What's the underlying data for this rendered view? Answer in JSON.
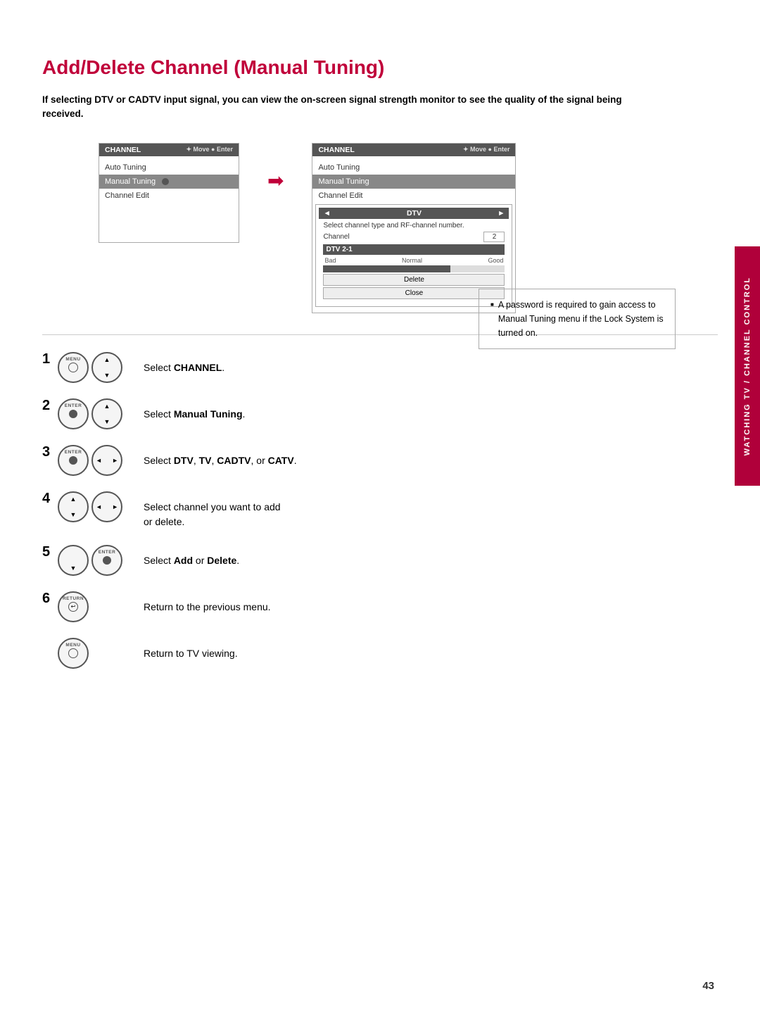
{
  "page": {
    "title": "Add/Delete Channel (Manual Tuning)",
    "description": "If selecting DTV or CADTV input signal, you can view the on-screen signal strength monitor to see the quality of the signal being received.",
    "page_number": "43",
    "side_tab": "WATCHING TV / CHANNEL CONTROL"
  },
  "menu1": {
    "header": "CHANNEL",
    "header_icons": "✦ Move  ● Enter",
    "item1": "Auto Tuning",
    "item2": "Manual Tuning",
    "item3": "Channel Edit"
  },
  "menu2": {
    "header": "CHANNEL",
    "header_icons": "✦ Move  ● Enter",
    "item1": "Auto Tuning",
    "item2": "Manual Tuning",
    "item3": "Channel Edit",
    "submenu_title": "DTV",
    "submenu_desc": "Select channel type and RF-channel number.",
    "submenu_channel_label": "Channel",
    "submenu_channel_value": "2",
    "submenu_dtv": "DTV 2-1",
    "submenu_bad": "Bad",
    "submenu_normal": "Normal",
    "submenu_good": "Good",
    "btn_delete": "Delete",
    "btn_close": "Close"
  },
  "steps": [
    {
      "number": "1",
      "icons": [
        "menu_circle",
        "nav_updown"
      ],
      "text": "Select ",
      "bold": "CHANNEL",
      "text_after": "."
    },
    {
      "number": "2",
      "icons": [
        "enter_circle",
        "nav_updown"
      ],
      "text": "Select ",
      "bold": "Manual  Tuning",
      "text_after": "."
    },
    {
      "number": "3",
      "icons": [
        "enter_circle",
        "nav_leftright"
      ],
      "text": "Select ",
      "bold_parts": [
        "DTV",
        "TV",
        "CADTV",
        "CATV"
      ],
      "text_template": "Select DTV, TV, CADTV, or CATV."
    },
    {
      "number": "4",
      "icons": [
        "nav_updown",
        "nav_leftright"
      ],
      "text": "Select channel you want to add\nor delete.",
      "bold": null
    },
    {
      "number": "5",
      "icons": [
        "nav_down_single",
        "enter_circle"
      ],
      "text": "Select ",
      "bold": "Add",
      "text_mid": " or ",
      "bold2": "Delete",
      "text_after": "."
    },
    {
      "number": "6",
      "icons": [
        "return_circle"
      ],
      "text": "Return to the previous menu.",
      "bold": null
    },
    {
      "number": "",
      "icons": [
        "menu_circle_bottom"
      ],
      "text": "Return to TV viewing.",
      "bold": null
    }
  ],
  "note": {
    "text": "A password is required to gain access to Manual Tuning menu if the Lock System is turned on."
  },
  "arrow": "➡"
}
